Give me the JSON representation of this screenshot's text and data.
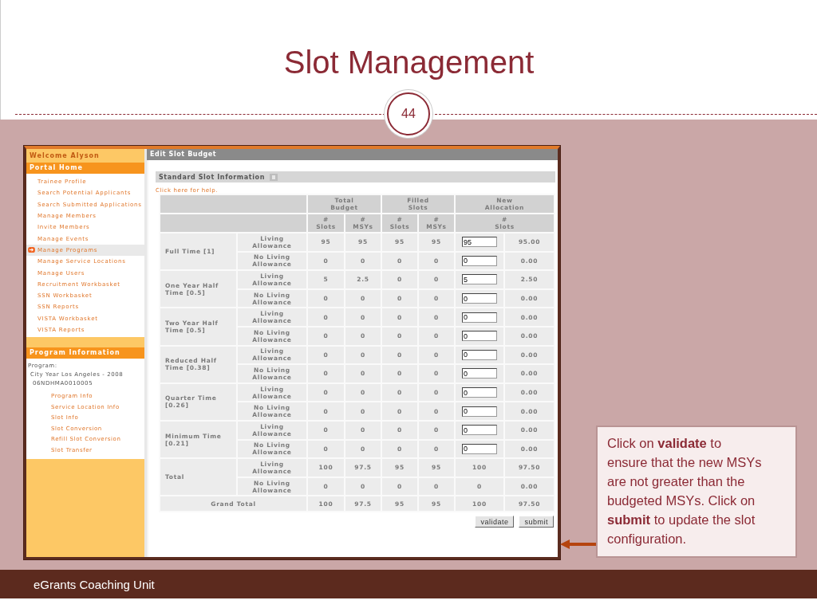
{
  "slide": {
    "title": "Slot Management",
    "number": "44",
    "footer": "eGrants Coaching Unit"
  },
  "sidebar": {
    "welcome": "Welcome Alyson",
    "portal_header": "Portal Home",
    "items": [
      {
        "label": "Trainee Profile",
        "selected": false
      },
      {
        "label": "Search Potential Applicants",
        "selected": false
      },
      {
        "label": "Search Submitted Applications",
        "selected": false
      },
      {
        "label": "Manage Members",
        "selected": false
      },
      {
        "label": "Invite Members",
        "selected": false
      },
      {
        "label": "Manage Events",
        "selected": false
      },
      {
        "label": "Manage Programs",
        "selected": true
      },
      {
        "label": "Manage Service Locations",
        "selected": false
      },
      {
        "label": "Manage Users",
        "selected": false
      },
      {
        "label": "Recruitment Workbasket",
        "selected": false
      },
      {
        "label": "SSN Workbasket",
        "selected": false
      },
      {
        "label": "SSN Reports",
        "selected": false
      },
      {
        "label": "VISTA Workbasket",
        "selected": false
      },
      {
        "label": "VISTA Reports",
        "selected": false
      }
    ],
    "program_header": "Program Information",
    "program_label": "Program:",
    "program_name": "City Year Los Angeles - 2008",
    "program_code": "06NDHMA0010005",
    "program_links": [
      "Program Info",
      "Service Location Info",
      "Slot Info",
      "Slot Conversion",
      "Refill Slot Conversion",
      "Slot Transfer"
    ]
  },
  "main": {
    "header": "Edit Slot Budget",
    "section": "Standard Slot Information",
    "help_link": "Click here for help.",
    "column_groups": [
      "Total Budget",
      "Filled Slots",
      "New Allocation"
    ],
    "columns": [
      "# Slots",
      "# MSYs",
      "# Slots",
      "# MSYs",
      "# Slots"
    ],
    "groups": [
      {
        "label": "Full Time [1]",
        "rows": [
          {
            "label": "Living Allowance",
            "kind": "input",
            "values": [
              "95",
              "95",
              "95",
              "95"
            ],
            "new_slots": "95",
            "new_msys": "95.00"
          },
          {
            "label": "No Living Allowance",
            "kind": "input",
            "values": [
              "0",
              "0",
              "0",
              "0"
            ],
            "new_slots": "0",
            "new_msys": "0.00"
          }
        ]
      },
      {
        "label": "One Year Half Time [0.5]",
        "rows": [
          {
            "label": "Living Allowance",
            "kind": "input",
            "values": [
              "5",
              "2.5",
              "0",
              "0"
            ],
            "new_slots": "5",
            "new_msys": "2.50"
          },
          {
            "label": "No Living Allowance",
            "kind": "input",
            "values": [
              "0",
              "0",
              "0",
              "0"
            ],
            "new_slots": "0",
            "new_msys": "0.00"
          }
        ]
      },
      {
        "label": "Two Year Half Time [0.5]",
        "rows": [
          {
            "label": "Living Allowance",
            "kind": "input",
            "values": [
              "0",
              "0",
              "0",
              "0"
            ],
            "new_slots": "0",
            "new_msys": "0.00"
          },
          {
            "label": "No Living Allowance",
            "kind": "input",
            "values": [
              "0",
              "0",
              "0",
              "0"
            ],
            "new_slots": "0",
            "new_msys": "0.00"
          }
        ]
      },
      {
        "label": "Reduced Half Time [0.38]",
        "rows": [
          {
            "label": "Living Allowance",
            "kind": "input",
            "values": [
              "0",
              "0",
              "0",
              "0"
            ],
            "new_slots": "0",
            "new_msys": "0.00"
          },
          {
            "label": "No Living Allowance",
            "kind": "input",
            "values": [
              "0",
              "0",
              "0",
              "0"
            ],
            "new_slots": "0",
            "new_msys": "0.00"
          }
        ]
      },
      {
        "label": "Quarter Time [0.26]",
        "rows": [
          {
            "label": "Living Allowance",
            "kind": "input",
            "values": [
              "0",
              "0",
              "0",
              "0"
            ],
            "new_slots": "0",
            "new_msys": "0.00"
          },
          {
            "label": "No Living Allowance",
            "kind": "input",
            "values": [
              "0",
              "0",
              "0",
              "0"
            ],
            "new_slots": "0",
            "new_msys": "0.00"
          }
        ]
      },
      {
        "label": "Minimum Time [0.21]",
        "rows": [
          {
            "label": "Living Allowance",
            "kind": "input",
            "values": [
              "0",
              "0",
              "0",
              "0"
            ],
            "new_slots": "0",
            "new_msys": "0.00"
          },
          {
            "label": "No Living Allowance",
            "kind": "input",
            "values": [
              "0",
              "0",
              "0",
              "0"
            ],
            "new_slots": "0",
            "new_msys": "0.00"
          }
        ]
      },
      {
        "label": "Total",
        "rows": [
          {
            "label": "Living Allowance",
            "kind": "text",
            "values": [
              "100",
              "97.5",
              "95",
              "95"
            ],
            "new_slots": "100",
            "new_msys": "97.50"
          },
          {
            "label": "No Living Allowance",
            "kind": "text",
            "values": [
              "0",
              "0",
              "0",
              "0"
            ],
            "new_slots": "0",
            "new_msys": "0.00"
          }
        ]
      }
    ],
    "grand_total": {
      "label": "Grand Total",
      "values": [
        "100",
        "97.5",
        "95",
        "95",
        "100",
        "97.50"
      ]
    },
    "buttons": [
      "validate",
      "submit"
    ]
  },
  "callout": "Click on **validate** to ensure that the new MSYs are not greater than the budgeted MSYs. Click on **submit** to update the slot configuration."
}
